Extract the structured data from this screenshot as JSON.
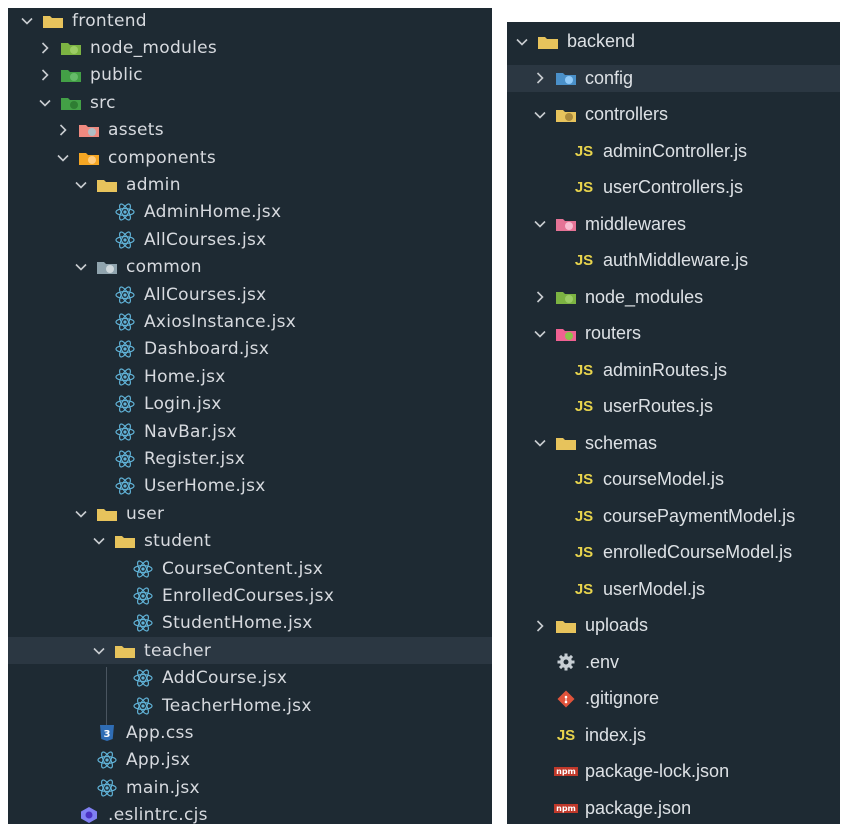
{
  "frontend_tree": [
    {
      "label": "frontend",
      "icon": "folder-icon",
      "open": true,
      "depth": 0
    },
    {
      "label": "node_modules",
      "icon": "folder-node-icon",
      "open": false,
      "depth": 1
    },
    {
      "label": "public",
      "icon": "folder-public-icon",
      "open": false,
      "depth": 1
    },
    {
      "label": "src",
      "icon": "folder-src-icon",
      "open": true,
      "depth": 1
    },
    {
      "label": "assets",
      "icon": "folder-assets-icon",
      "open": false,
      "depth": 2
    },
    {
      "label": "components",
      "icon": "folder-components-icon",
      "open": true,
      "depth": 2
    },
    {
      "label": "admin",
      "icon": "folder-icon",
      "open": true,
      "depth": 3
    },
    {
      "label": "AdminHome.jsx",
      "icon": "react-icon",
      "depth": 4
    },
    {
      "label": "AllCourses.jsx",
      "icon": "react-icon",
      "depth": 4
    },
    {
      "label": "common",
      "icon": "folder-common-icon",
      "open": true,
      "depth": 3
    },
    {
      "label": "AllCourses.jsx",
      "icon": "react-icon",
      "depth": 4
    },
    {
      "label": "AxiosInstance.jsx",
      "icon": "react-icon",
      "depth": 4
    },
    {
      "label": "Dashboard.jsx",
      "icon": "react-icon",
      "depth": 4
    },
    {
      "label": "Home.jsx",
      "icon": "react-icon",
      "depth": 4
    },
    {
      "label": "Login.jsx",
      "icon": "react-icon",
      "depth": 4
    },
    {
      "label": "NavBar.jsx",
      "icon": "react-icon",
      "depth": 4
    },
    {
      "label": "Register.jsx",
      "icon": "react-icon",
      "depth": 4
    },
    {
      "label": "UserHome.jsx",
      "icon": "react-icon",
      "depth": 4
    },
    {
      "label": "user",
      "icon": "folder-icon",
      "open": true,
      "depth": 3
    },
    {
      "label": "student",
      "icon": "folder-icon",
      "open": true,
      "depth": 4
    },
    {
      "label": "CourseContent.jsx",
      "icon": "react-icon",
      "depth": 5
    },
    {
      "label": "EnrolledCourses.jsx",
      "icon": "react-icon",
      "depth": 5
    },
    {
      "label": "StudentHome.jsx",
      "icon": "react-icon",
      "depth": 5
    },
    {
      "label": "teacher",
      "icon": "folder-icon",
      "open": true,
      "depth": 4,
      "selected": true
    },
    {
      "label": "AddCourse.jsx",
      "icon": "react-icon",
      "depth": 5
    },
    {
      "label": "TeacherHome.jsx",
      "icon": "react-icon",
      "depth": 5
    },
    {
      "label": "App.css",
      "icon": "css-icon",
      "depth": 3
    },
    {
      "label": "App.jsx",
      "icon": "react-icon",
      "depth": 3
    },
    {
      "label": "main.jsx",
      "icon": "react-icon",
      "depth": 3
    },
    {
      "label": ".eslintrc.cjs",
      "icon": "eslint-icon",
      "depth": 2
    }
  ],
  "backend_tree": [
    {
      "label": "backend",
      "icon": "folder-icon",
      "open": true,
      "depth": 0
    },
    {
      "label": "config",
      "icon": "folder-config-icon",
      "open": false,
      "depth": 1,
      "selected": true
    },
    {
      "label": "controllers",
      "icon": "folder-controllers-icon",
      "open": true,
      "depth": 1
    },
    {
      "label": "adminController.js",
      "icon": "js-icon",
      "depth": 2
    },
    {
      "label": "userControllers.js",
      "icon": "js-icon",
      "depth": 2
    },
    {
      "label": "middlewares",
      "icon": "folder-middlewares-icon",
      "open": true,
      "depth": 1
    },
    {
      "label": "authMiddleware.js",
      "icon": "js-icon",
      "depth": 2
    },
    {
      "label": "node_modules",
      "icon": "folder-node-icon",
      "open": false,
      "depth": 1
    },
    {
      "label": "routers",
      "icon": "folder-routers-icon",
      "open": true,
      "depth": 1
    },
    {
      "label": "adminRoutes.js",
      "icon": "js-icon",
      "depth": 2
    },
    {
      "label": "userRoutes.js",
      "icon": "js-icon",
      "depth": 2
    },
    {
      "label": "schemas",
      "icon": "folder-icon",
      "open": true,
      "depth": 1
    },
    {
      "label": "courseModel.js",
      "icon": "js-icon",
      "depth": 2
    },
    {
      "label": "coursePaymentModel.js",
      "icon": "js-icon",
      "depth": 2
    },
    {
      "label": "enrolledCourseModel.js",
      "icon": "js-icon",
      "depth": 2
    },
    {
      "label": "userModel.js",
      "icon": "js-icon",
      "depth": 2
    },
    {
      "label": "uploads",
      "icon": "folder-icon",
      "open": false,
      "depth": 1
    },
    {
      "label": ".env",
      "icon": "gear-icon",
      "depth": 1
    },
    {
      "label": ".gitignore",
      "icon": "git-icon",
      "depth": 1
    },
    {
      "label": "index.js",
      "icon": "js-icon",
      "depth": 1
    },
    {
      "label": "package-lock.json",
      "icon": "npm-icon",
      "depth": 1
    },
    {
      "label": "package.json",
      "icon": "npm-icon",
      "depth": 1
    }
  ],
  "js_badge": "JS",
  "css_badge": "3",
  "npm_badge": "npm",
  "colors": {
    "panel_bg": "#1e2a33",
    "selected_bg": "#2b3742",
    "folder": "#e6c35c",
    "react": "#61b3d8",
    "js": "#e8d44d",
    "node": "#8bc34a",
    "css": "#2f6db5",
    "git": "#e0533b",
    "npm": "#c0392b"
  }
}
